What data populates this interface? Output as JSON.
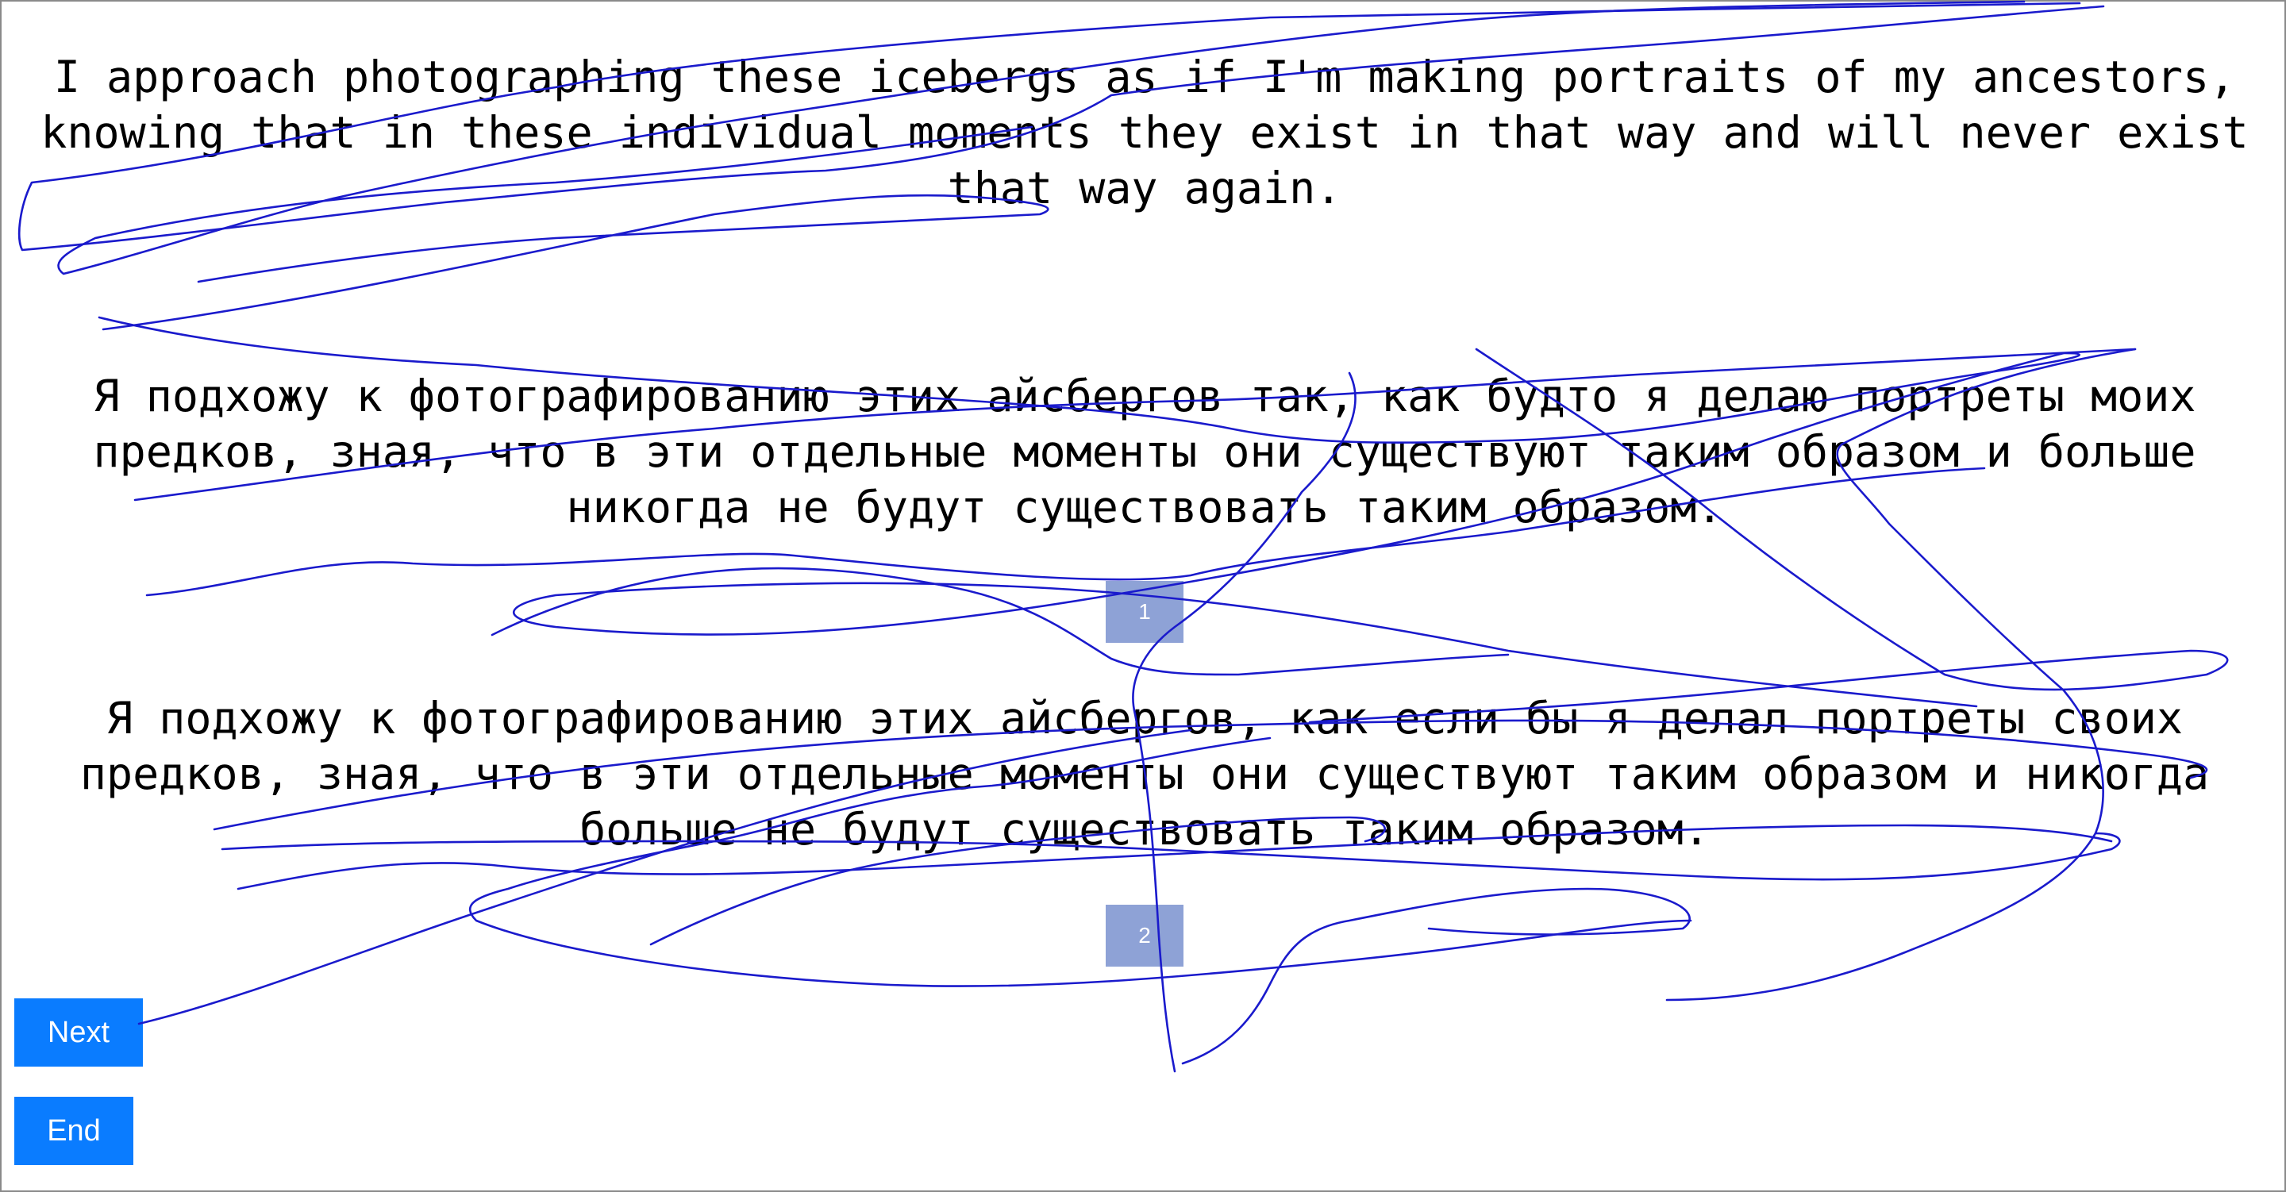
{
  "passages": {
    "source": "I approach photographing these icebergs as if I'm making portraits of my ancestors, knowing that in these individual moments they exist in that way and will never exist that way again.",
    "option1": "Я подхожу к фотографированию этих айсбергов так, как будто я делаю портреты моих предков, зная, что в эти отдельные моменты они существуют таким образом и больше никогда не будут существовать таким образом.",
    "option2": "Я подхожу к фотографированию этих айсбергов, как если бы я делал портреты своих предков, зная, что в эти отдельные моменты они существуют таким образом и никогда больше не будут существовать таким образом."
  },
  "choices": {
    "one": "1",
    "two": "2"
  },
  "buttons": {
    "next": "Next",
    "end": "End"
  },
  "colors": {
    "choice_button": "#8ea2d6",
    "nav_button": "#0a7cff",
    "scribble_stroke": "#1a1acc"
  }
}
